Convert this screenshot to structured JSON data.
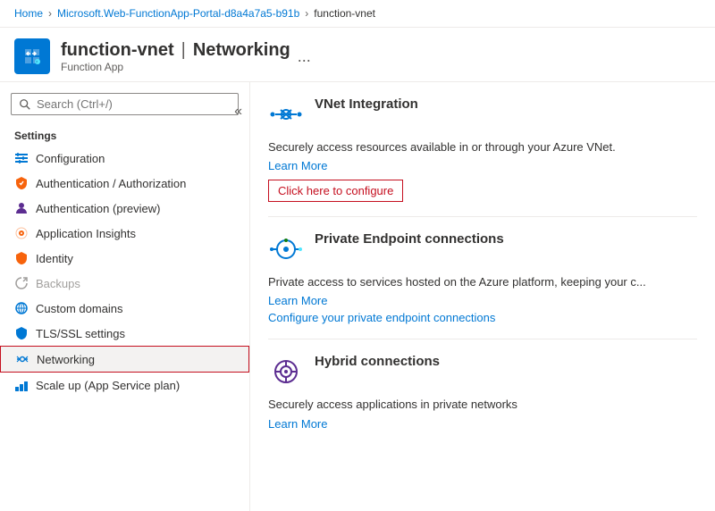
{
  "breadcrumb": {
    "home": "Home",
    "subscription": "Microsoft.Web-FunctionApp-Portal-d8a4a7a5-b91b",
    "current": "function-vnet"
  },
  "header": {
    "title": "function-vnet",
    "separator": "|",
    "page": "Networking",
    "subtitle": "Function App",
    "ellipsis": "..."
  },
  "sidebar": {
    "search_placeholder": "Search (Ctrl+/)",
    "collapse_icon": "«",
    "sections": [
      {
        "label": "Settings",
        "items": [
          {
            "id": "configuration",
            "label": "Configuration",
            "icon": "sliders"
          },
          {
            "id": "auth-auth",
            "label": "Authentication / Authorization",
            "icon": "key"
          },
          {
            "id": "auth-preview",
            "label": "Authentication (preview)",
            "icon": "person"
          },
          {
            "id": "app-insights",
            "label": "Application Insights",
            "icon": "lightbulb"
          },
          {
            "id": "identity",
            "label": "Identity",
            "icon": "key2"
          },
          {
            "id": "backups",
            "label": "Backups",
            "icon": "backup",
            "disabled": true
          },
          {
            "id": "custom-domains",
            "label": "Custom domains",
            "icon": "globe"
          },
          {
            "id": "tls-ssl",
            "label": "TLS/SSL settings",
            "icon": "shield"
          },
          {
            "id": "networking",
            "label": "Networking",
            "icon": "network",
            "active": true
          },
          {
            "id": "scale-up",
            "label": "Scale up (App Service plan)",
            "icon": "scale"
          }
        ]
      }
    ]
  },
  "content": {
    "sections": [
      {
        "id": "vnet",
        "title": "VNet Integration",
        "description": "Securely access resources available in or through your Azure VNet.",
        "learn_more": "Learn More",
        "configure_label": "Click here to configure",
        "icon_type": "vnet"
      },
      {
        "id": "private-endpoint",
        "title": "Private Endpoint connections",
        "description": "Private access to services hosted on the Azure platform, keeping your c...",
        "learn_more": "Learn More",
        "configure_label": "Configure your private endpoint connections",
        "icon_type": "private"
      },
      {
        "id": "hybrid",
        "title": "Hybrid connections",
        "description": "Securely access applications in private networks",
        "learn_more": "Learn More",
        "icon_type": "hybrid"
      }
    ]
  }
}
